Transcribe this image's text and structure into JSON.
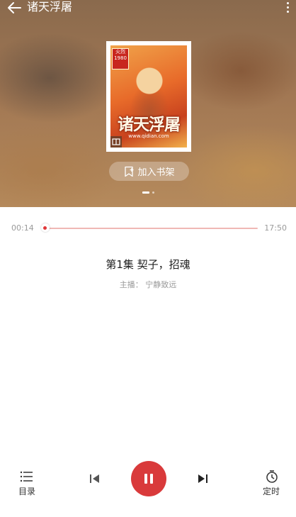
{
  "header": {
    "title": "诸天浮屠"
  },
  "cover": {
    "badge_line1": "火烈",
    "badge_line2": "1980",
    "title_text": "诸天浮屠",
    "url_text": "www.qidian.com"
  },
  "actions": {
    "add_to_shelf": "加入书架"
  },
  "player": {
    "current_time": "00:14",
    "total_time": "17:50",
    "progress": 0.013,
    "episode_title": "第1集 契子，招魂",
    "anchor": "主播： 宁静致远"
  },
  "controls": {
    "catalog_label": "目录",
    "timer_label": "定时"
  },
  "colors": {
    "accent": "#d93a3b",
    "track": "#f0b8b5"
  }
}
